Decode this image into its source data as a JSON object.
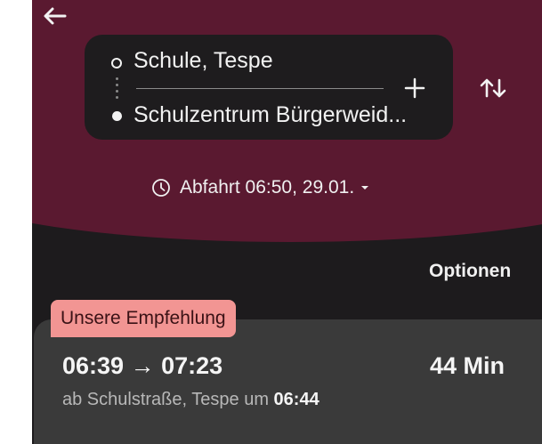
{
  "colors": {
    "header": "#5a1930",
    "background": "#1d1b1d",
    "card": "#3a3a3a",
    "badge": "#f29593",
    "text": "#f0f0f0",
    "muted_text": "#b8b8b8"
  },
  "header": {
    "back_icon": "arrow-left-icon",
    "swap_icon": "swap-vertical-icon",
    "add_icon": "plus-icon"
  },
  "route": {
    "origin": "Schule, Tespe",
    "destination": "Schulzentrum Bürgerweid..."
  },
  "time_selector": {
    "icon": "clock-icon",
    "label": "Abfahrt 06:50, 29.01.",
    "dropdown_icon": "caret-down-icon"
  },
  "options_label": "Optionen",
  "recommendation": {
    "badge": "Unsere Empfehlung",
    "departure_time": "06:39",
    "arrow": "→",
    "arrival_time": "07:23",
    "duration": "44 Min",
    "stop_prefix": "ab Schulstraße, Tespe um",
    "stop_time": "06:44"
  }
}
